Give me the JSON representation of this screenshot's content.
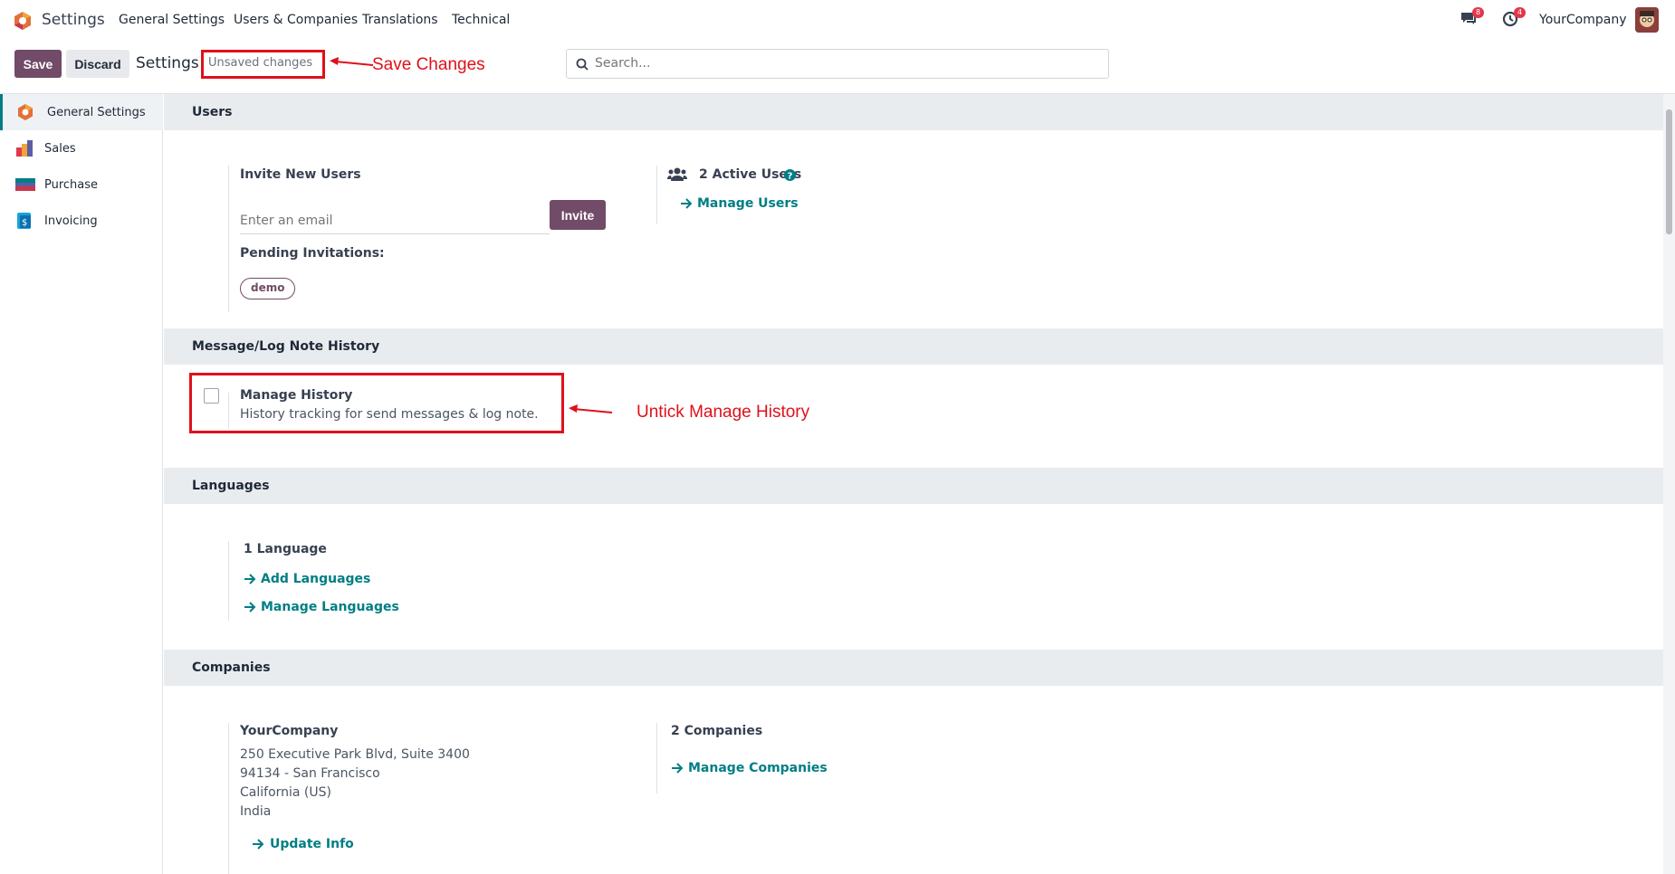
{
  "app": {
    "title": "Settings",
    "menu": [
      "General Settings",
      "Users & Companies",
      "Translations",
      "Technical"
    ],
    "messages_count": "8",
    "activities_count": "4",
    "company": "YourCompany"
  },
  "controls": {
    "save_label": "Save",
    "discard_label": "Discard",
    "breadcrumb": "Settings",
    "unsaved": "Unsaved changes",
    "search_placeholder": "Search..."
  },
  "annotations": {
    "save": "Save Changes",
    "history": "Untick Manage History"
  },
  "sidebar": {
    "items": [
      {
        "label": "General Settings",
        "icon": "settings-logo-icon"
      },
      {
        "label": "Sales",
        "icon": "sales-icon"
      },
      {
        "label": "Purchase",
        "icon": "purchase-icon"
      },
      {
        "label": "Invoicing",
        "icon": "invoicing-icon"
      }
    ]
  },
  "users": {
    "title": "Users",
    "invite_label": "Invite New Users",
    "email_placeholder": "Enter an email",
    "invite_button": "Invite",
    "pending_label": "Pending Invitations:",
    "pending": [
      "demo"
    ],
    "active_users": "2 Active Users",
    "manage_users": "Manage Users"
  },
  "history": {
    "title": "Message/Log Note History",
    "label": "Manage History",
    "description": "History tracking for send messages & log note."
  },
  "languages": {
    "title": "Languages",
    "count": "1 Language",
    "add": "Add Languages",
    "manage": "Manage Languages"
  },
  "companies": {
    "title": "Companies",
    "name": "YourCompany",
    "address": [
      "250 Executive Park Blvd, Suite 3400",
      "94134 - San Francisco",
      "California (US)",
      "India"
    ],
    "update": "Update Info",
    "count": "2 Companies",
    "manage": "Manage Companies"
  },
  "colors": {
    "primary": "#714b67",
    "link": "#017e84",
    "annotation": "#e0101a",
    "section_bg": "#e9ecef"
  }
}
